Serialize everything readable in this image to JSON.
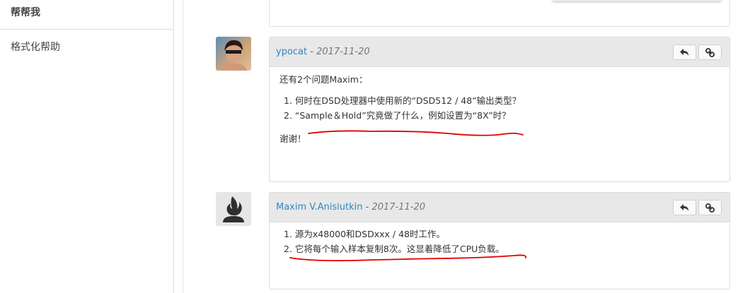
{
  "sidebar": {
    "title": "帮帮我",
    "items": [
      {
        "label": "格式化帮助"
      }
    ]
  },
  "comments": [
    {
      "author": "ypocat",
      "separator": " - ",
      "date": "2017-11-20",
      "intro": "还有2个问题Maxim：",
      "items": [
        "1. 何时在DSD处理器中使用新的“DSD512 / 48”输出类型？",
        "2. “Sample＆Hold”究竟做了什么，例如设置为“8X”时？"
      ],
      "outro": "谢谢！"
    },
    {
      "author": "Maxim V.Anisiutkin",
      "separator": " - ",
      "date": "2017-11-20",
      "items": [
        "1. 源为x48000和DSDxxx / 48时工作。",
        "2. 它将每个输入样本复制8次。这显着降低了CPU负载。"
      ]
    }
  ],
  "colors": {
    "link": "#2f87c0",
    "annotation": "#e00000",
    "header_bg": "#e8e8e8"
  },
  "icons": [
    "reply-icon",
    "link-icon",
    "user-avatar-icon"
  ]
}
